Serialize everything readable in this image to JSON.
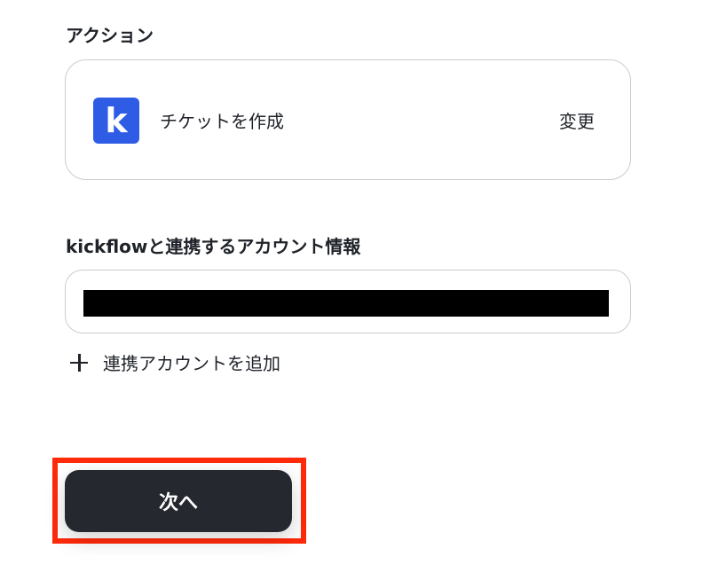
{
  "action_section": {
    "label": "アクション",
    "card": {
      "app_logo_letter": "k",
      "app_logo_color": "#2e5ce5",
      "title": "チケットを作成",
      "change_label": "変更"
    }
  },
  "account_section": {
    "label": "kickflowと連携するアカウント情報",
    "add_account_label": "連携アカウントを追加"
  },
  "footer": {
    "next_label": "次へ",
    "highlight_color": "#ff2a0a"
  }
}
